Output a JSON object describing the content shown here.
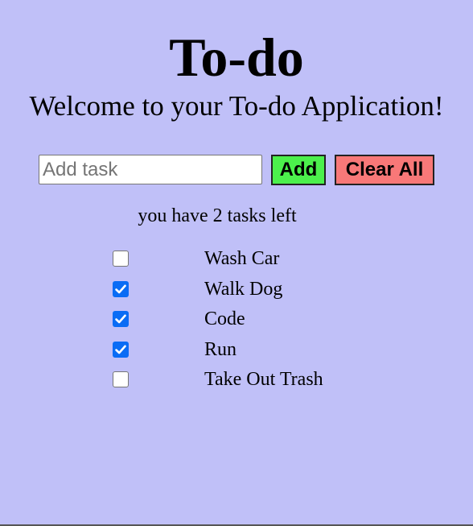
{
  "header": {
    "title": "To-do",
    "subtitle": "Welcome to your To-do Application!"
  },
  "form": {
    "input_value": "",
    "input_placeholder": "Add task",
    "add_label": "Add",
    "clear_label": "Clear All"
  },
  "status": {
    "tasks_left_text": "you have 2 tasks left"
  },
  "tasks": [
    {
      "label": "Wash Car",
      "done": false
    },
    {
      "label": "Walk Dog",
      "done": true
    },
    {
      "label": "Code",
      "done": true
    },
    {
      "label": "Run",
      "done": true
    },
    {
      "label": "Take Out Trash",
      "done": false
    }
  ],
  "colors": {
    "background": "#c0c0f8",
    "add_button": "#4cf04c",
    "clear_button": "#f87878",
    "checkbox_checked": "#0a6cf5"
  },
  "icons": {
    "checkmark": "checkmark-icon"
  }
}
